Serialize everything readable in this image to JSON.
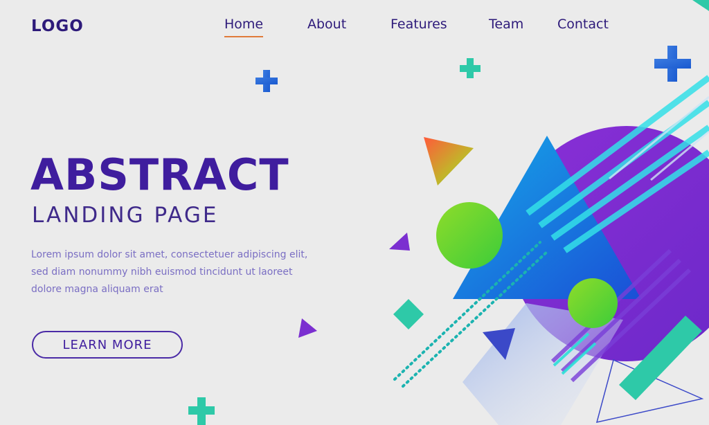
{
  "header": {
    "logo": "LOGO",
    "nav": [
      {
        "label": "Home",
        "active": true
      },
      {
        "label": "About",
        "active": false
      },
      {
        "label": "Features",
        "active": false
      },
      {
        "label": "Team",
        "active": false
      },
      {
        "label": "Contact",
        "active": false
      }
    ]
  },
  "hero": {
    "title": "ABSTRACT",
    "subtitle": "LANDING PAGE",
    "body": "Lorem ipsum dolor sit amet, consectetuer adipiscing elit, sed diam nonummy nibh euismod tincidunt ut laoreet dolore magna aliquam erat",
    "cta_label": "LEARN MORE"
  },
  "colors": {
    "title": "#3f1d9e",
    "accent_underline": "#e07a3a",
    "purple": "#7b2fd0",
    "blue": "#1d6fe0",
    "teal": "#2ec9a8",
    "green": "#5fd42a"
  }
}
